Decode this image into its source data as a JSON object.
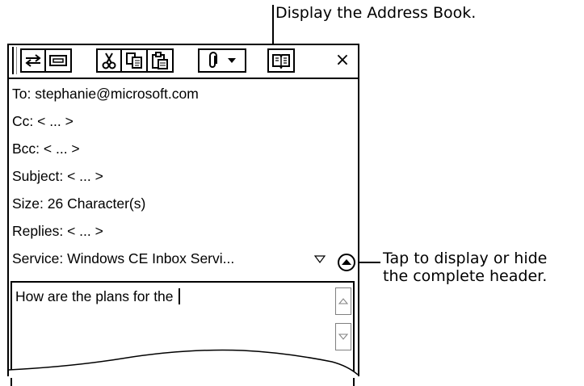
{
  "callouts": {
    "address_book": "Display the Address Book.",
    "header_line1": "Tap to display or hide",
    "header_line2": "the complete header."
  },
  "toolbar": {
    "icons": [
      "send-receive-icon",
      "properties-icon",
      "cut-icon",
      "copy-icon",
      "paste-icon",
      "attachment-icon",
      "dropdown-arrow-icon",
      "address-book-icon",
      "close-icon"
    ],
    "close_label": "×"
  },
  "header": {
    "to": "To: stephanie@microsoft.com",
    "cc": "Cc: < ... >",
    "bcc": "Bcc: < ... >",
    "subject": "Subject: < ... >",
    "size": "Size: 26 Character(s)",
    "replies": "Replies: < ... >",
    "service": "Service: Windows CE Inbox Servi..."
  },
  "message": {
    "text": "How are the plans for the"
  }
}
